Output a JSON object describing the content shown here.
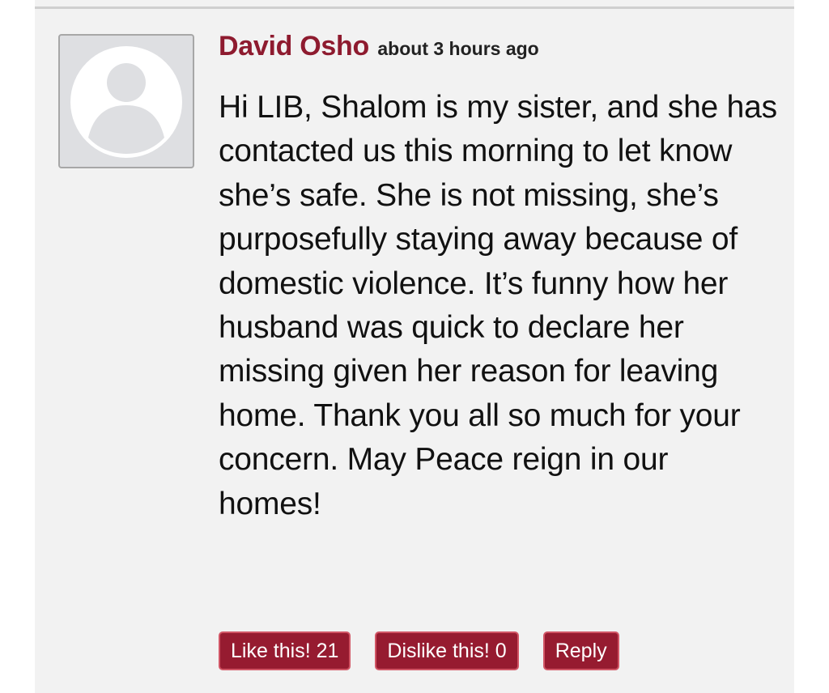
{
  "comment": {
    "author": "David Osho",
    "timestamp": "about 3 hours ago",
    "avatar_icon": "default-user-avatar-icon",
    "body": "Hi LIB, Shalom is my sister, and she has contacted us this morning to let know she’s safe. She is not missing, she’s purposefully staying away because of domestic violence. It’s funny how her husband was quick to declare her missing given her reason for leaving home. Thank you all so much for your concern. May Peace reign in our homes!",
    "actions": {
      "like_label": "Like this!",
      "like_count": "21",
      "dislike_label": "Dislike this!",
      "dislike_count": "0",
      "reply_label": "Reply"
    }
  },
  "colors": {
    "author_name": "#8e1b2f",
    "button_background": "#961b30",
    "button_border": "#d15565",
    "card_background": "#f2f2f2",
    "avatar_background": "#dedfe2"
  }
}
